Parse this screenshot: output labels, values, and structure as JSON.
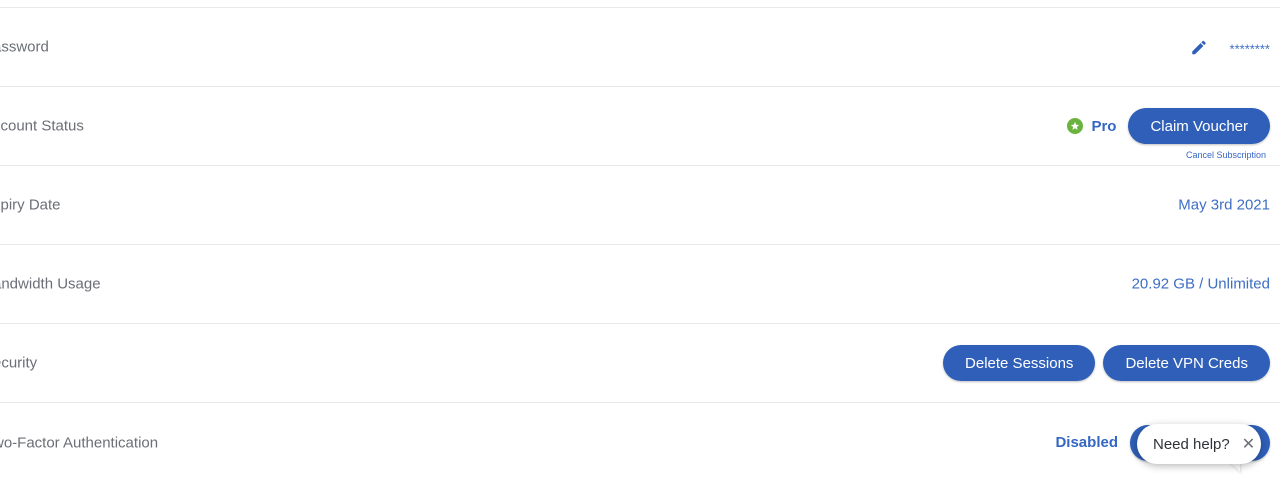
{
  "rows": {
    "password": {
      "label": "assword",
      "masked_value": "********"
    },
    "account_status": {
      "label": "ccount Status",
      "plan": "Pro",
      "claim_button": "Claim Voucher",
      "cancel_link": "Cancel Subscription"
    },
    "expiry": {
      "label": "xpiry Date",
      "value": "May 3rd 2021"
    },
    "bandwidth": {
      "label": "andwidth Usage",
      "value": "20.92 GB / Unlimited"
    },
    "security": {
      "label": "ecurity",
      "delete_sessions": "Delete Sessions",
      "delete_vpn_creds": "Delete VPN Creds"
    },
    "two_factor": {
      "label": "wo-Factor Authentication",
      "status": "Disabled"
    }
  },
  "help_widget": {
    "text": "Need help?",
    "close": "✕"
  },
  "colors": {
    "accent": "#2f5fb8",
    "link": "#3e6fc4",
    "pro_badge": "#6ab33e"
  }
}
